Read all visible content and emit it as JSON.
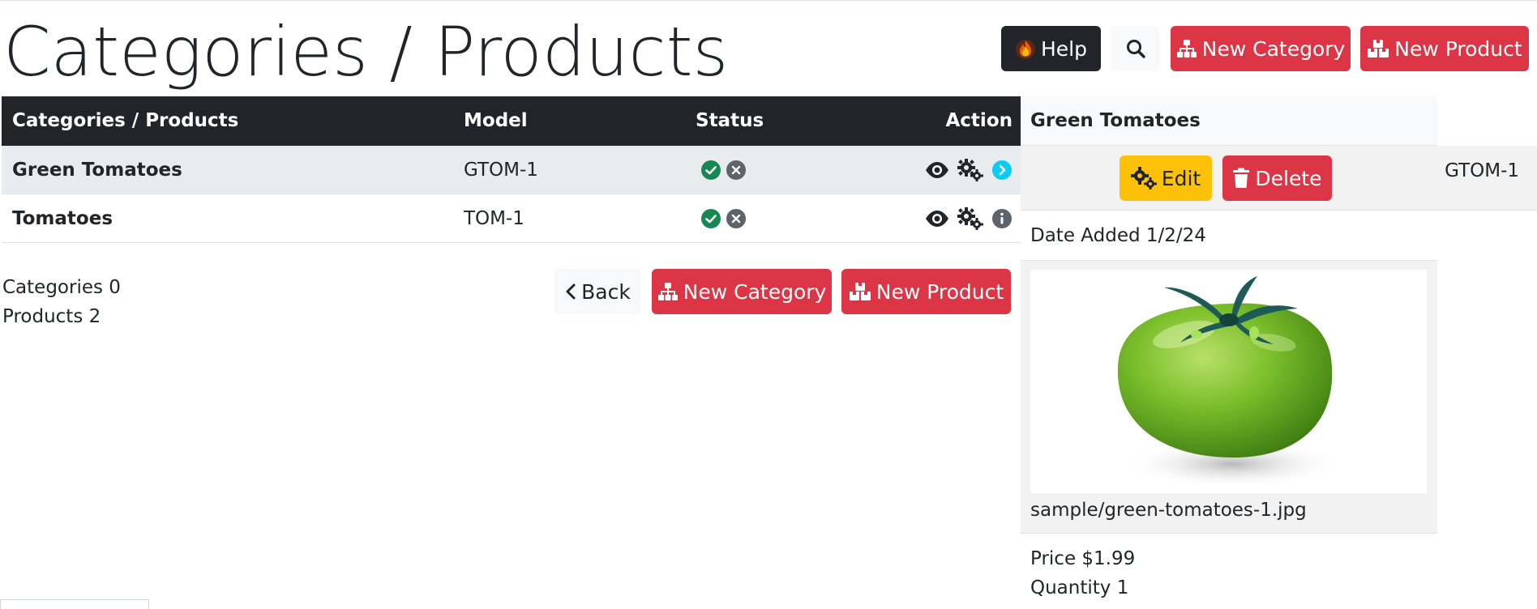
{
  "page": {
    "title": "Categories / Products"
  },
  "header": {
    "help_label": "Help",
    "new_category_label": "New Category",
    "new_product_label": "New Product"
  },
  "table": {
    "columns": [
      "Categories / Products",
      "Model",
      "Status",
      "Action"
    ],
    "rows": [
      {
        "name": "Green Tomatoes",
        "model": "GTOM-1"
      },
      {
        "name": "Tomatoes",
        "model": "TOM-1"
      }
    ]
  },
  "summary": {
    "categories": "Categories 0",
    "products": "Products 2"
  },
  "footer_actions": {
    "back_label": "Back",
    "new_category_label": "New Category",
    "new_product_label": "New Product"
  },
  "detail": {
    "title": "Green Tomatoes",
    "edit_label": "Edit",
    "delete_label": "Delete",
    "model": "GTOM-1",
    "date_added": "Date Added 1/2/24",
    "image_path": "sample/green-tomatoes-1.jpg",
    "price": "Price $1.99",
    "quantity": "Quantity 1"
  },
  "colors": {
    "dark": "#212529",
    "danger": "#dc3545",
    "warning": "#ffc107",
    "success": "#198754",
    "secondary": "#5c636a",
    "info": "#0dcaf0"
  },
  "icons": [
    "fire-icon",
    "search-icon",
    "sitemap-icon",
    "boxes-icon",
    "check-circle-icon",
    "x-circle-icon",
    "eye-icon",
    "gears-icon",
    "chevron-right-circle-icon",
    "info-circle-icon",
    "chevron-left-icon",
    "trash-icon"
  ]
}
